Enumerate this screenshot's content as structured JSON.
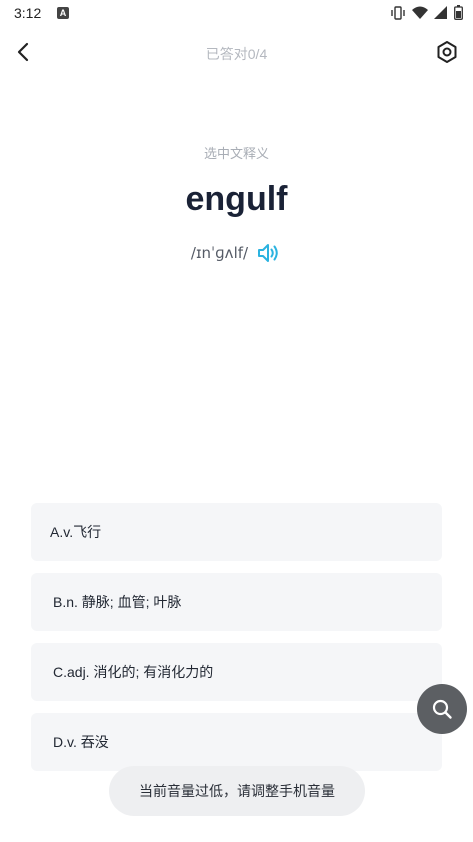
{
  "status_bar": {
    "time": "3:12",
    "app_icon_letter": "A"
  },
  "header": {
    "progress": "已答对0/4",
    "back_icon": "chevron-left-icon",
    "settings_icon": "hexagon-gear-icon"
  },
  "question": {
    "instruction": "选中文释义",
    "word": "engulf",
    "phonetic": "/ɪnˈɡʌlf/",
    "speaker_icon": "speaker-icon",
    "accent_color": "#2bb3e0"
  },
  "options": [
    {
      "label": "A.v.飞行"
    },
    {
      "label": "B.n. 静脉; 血管; 叶脉"
    },
    {
      "label": "C.adj. 消化的; 有消化力的"
    },
    {
      "label": "D.v. 吞没"
    }
  ],
  "fab": {
    "icon": "search-icon"
  },
  "toast": {
    "message": "当前音量过低，请调整手机音量"
  }
}
